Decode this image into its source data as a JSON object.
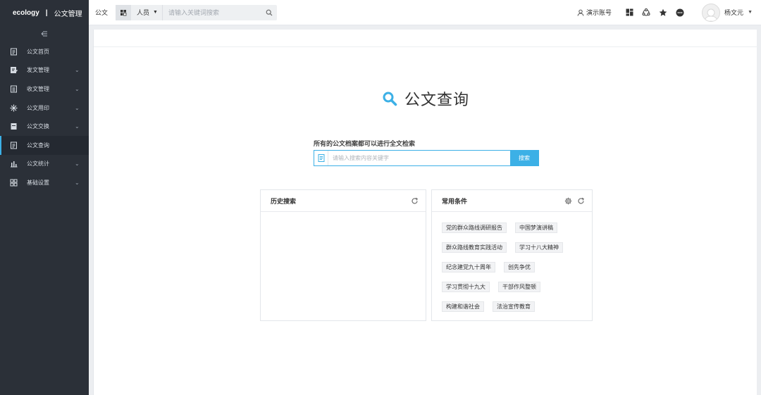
{
  "brand": {
    "name": "ecology",
    "separator": "|",
    "app": "公文管理"
  },
  "sidebar": {
    "items": [
      {
        "label": "公文首页",
        "icon": "doc-icon",
        "chevron": ""
      },
      {
        "label": "发文管理",
        "icon": "edit-doc-icon",
        "chevron": "⌄"
      },
      {
        "label": "收文管理",
        "icon": "inbox-doc-icon",
        "chevron": "⌄"
      },
      {
        "label": "公文用印",
        "icon": "seal-icon",
        "chevron": "⌄"
      },
      {
        "label": "公文交换",
        "icon": "exchange-icon",
        "chevron": "⌄"
      },
      {
        "label": "公文查询",
        "icon": "search-doc-icon",
        "chevron": ""
      },
      {
        "label": "公文统计",
        "icon": "bar-chart-icon",
        "chevron": "⌄"
      },
      {
        "label": "基础设置",
        "icon": "settings-grid-icon",
        "chevron": "⌄"
      }
    ]
  },
  "topbar": {
    "crumb": "公文",
    "people_select": "人员",
    "search_placeholder": "请输入关键词搜索",
    "demo_label": "演示账号",
    "user_name": "杨文元"
  },
  "hero": {
    "title": "公文查询"
  },
  "search": {
    "hint": "所有的公文档案都可以进行全文检索",
    "placeholder": "请输入搜索内容关键字",
    "button": "搜索"
  },
  "history": {
    "title": "历史搜索"
  },
  "common": {
    "title": "常用条件",
    "tags": [
      [
        "党的群众路线调研报告",
        "中国梦演讲稿"
      ],
      [
        "群众路线教育实践活动",
        "学习十八大精神"
      ],
      [
        "纪念建党九十周年",
        "创先争优"
      ],
      [
        "学习贯彻十九大",
        "干部作风整顿"
      ],
      [
        "构建和谐社会",
        "法治宣传教育"
      ]
    ]
  },
  "colors": {
    "accent": "#3cb0e6",
    "sidebar_bg": "#2b3038"
  }
}
